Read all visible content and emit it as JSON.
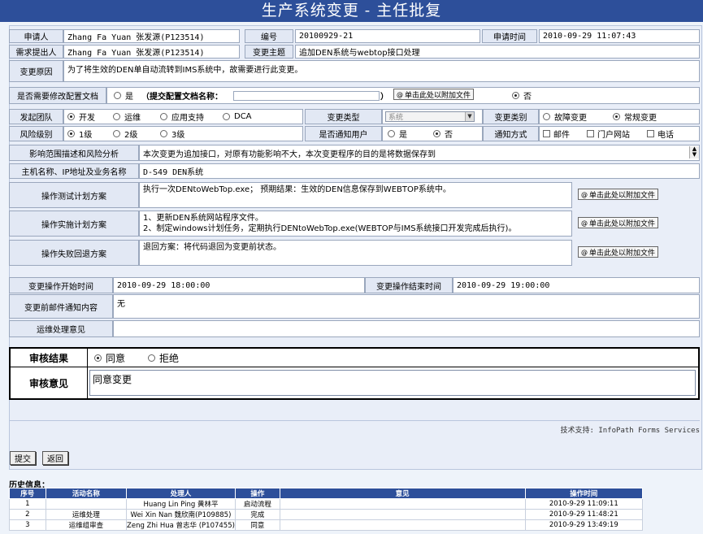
{
  "page_title": "生产系统变更 - 主任批复",
  "row1": {
    "applicant_label": "申请人",
    "applicant_value": "Zhang Fa Yuan 张发源(P123514)",
    "number_label": "编号",
    "number_value": "20100929-21",
    "time_label": "申请时间",
    "time_value": "2010-09-29 11:07:43"
  },
  "row2": {
    "proposer_label": "需求提出人",
    "proposer_value": "Zhang Fa Yuan 张发源(P123514)",
    "subject_label": "变更主题",
    "subject_value": "追加DEN系统与webtop接口处理"
  },
  "row3": {
    "reason_label": "变更原因",
    "reason_value": "为了将生效的DEN单自动流转到IMS系统中，故需要进行此变更。"
  },
  "row4": {
    "label": "是否需要修改配置文档",
    "yes": "是",
    "doc_name_label": "（提交配置文档名称：",
    "close_paren": "）",
    "attach": "单击此处以附加文件",
    "no": "否"
  },
  "row5": {
    "team_label": "发起团队",
    "team_options": [
      "开发",
      "运维",
      "应用支持",
      "DCA"
    ],
    "type_label": "变更类型",
    "type_value": "系统",
    "category_label": "变更类别",
    "category_options": [
      "故障变更",
      "常规变更"
    ]
  },
  "row6": {
    "risk_label": "风险级别",
    "risk_options": [
      "1级",
      "2级",
      "3级"
    ],
    "notify_label": "是否通知用户",
    "notify_yes": "是",
    "notify_no": "否",
    "method_label": "通知方式",
    "methods": [
      "邮件",
      "门户网站",
      "电话"
    ]
  },
  "row7": {
    "label": "影响范围描述和风险分析",
    "value": "本次变更为追加接口，对原有功能影响不大，本次变更程序的目的是将数据保存到"
  },
  "row8": {
    "label": "主机名称、IP地址及业务名称",
    "value": "D-S49 DEN系统"
  },
  "row9": {
    "label": "操作测试计划方案",
    "value": "执行一次DENtoWebTop.exe；   预期结果：生效的DEN信息保存到WEBTOP系统中。",
    "attach": "单击此处以附加文件"
  },
  "row10": {
    "label": "操作实施计划方案",
    "line1": "1、更新DEN系统网站程序文件。",
    "line2": "2、制定windows计划任务，定期执行DENtoWebTop.exe(WEBTOP与IMS系统接口开发完成后执行)。",
    "attach": "单击此处以附加文件"
  },
  "row11": {
    "label": "操作失败回退方案",
    "value": "退回方案：将代码退回为变更前状态。",
    "attach": "单击此处以附加文件"
  },
  "row12": {
    "start_label": "变更操作开始时间",
    "start_value": "2010-09-29 18:00:00",
    "end_label": "变更操作结束时间",
    "end_value": "2010-09-29 19:00:00"
  },
  "row13": {
    "label": "变更前邮件通知内容",
    "value": "无"
  },
  "row14": {
    "label": "运维处理意见",
    "value": ""
  },
  "review": {
    "result_label": "审核结果",
    "agree": "同意",
    "reject": "拒绝",
    "opinion_label": "审核意见",
    "opinion_value": "同意变更"
  },
  "support_text": "技术支持: InfoPath Forms Services",
  "buttons": {
    "submit": "提交",
    "back": "返回"
  },
  "history": {
    "title": "历史信息：",
    "columns": [
      "序号",
      "活动名称",
      "处理人",
      "操作",
      "意见",
      "操作时间"
    ],
    "rows": [
      [
        "1",
        "",
        "Huang Lin Ping 黄林平",
        "启动流程",
        "",
        "2010-9-29 11:09:11"
      ],
      [
        "2",
        "运维处理",
        "Wei Xin Nan 魏欣南(P109885)",
        "完成",
        "",
        "2010-9-29 11:48:21"
      ],
      [
        "3",
        "运维组审查",
        "Zeng Zhi Hua 曾志华 (P107455)",
        "同意",
        "",
        "2010-9-29 13:49:19"
      ]
    ]
  }
}
